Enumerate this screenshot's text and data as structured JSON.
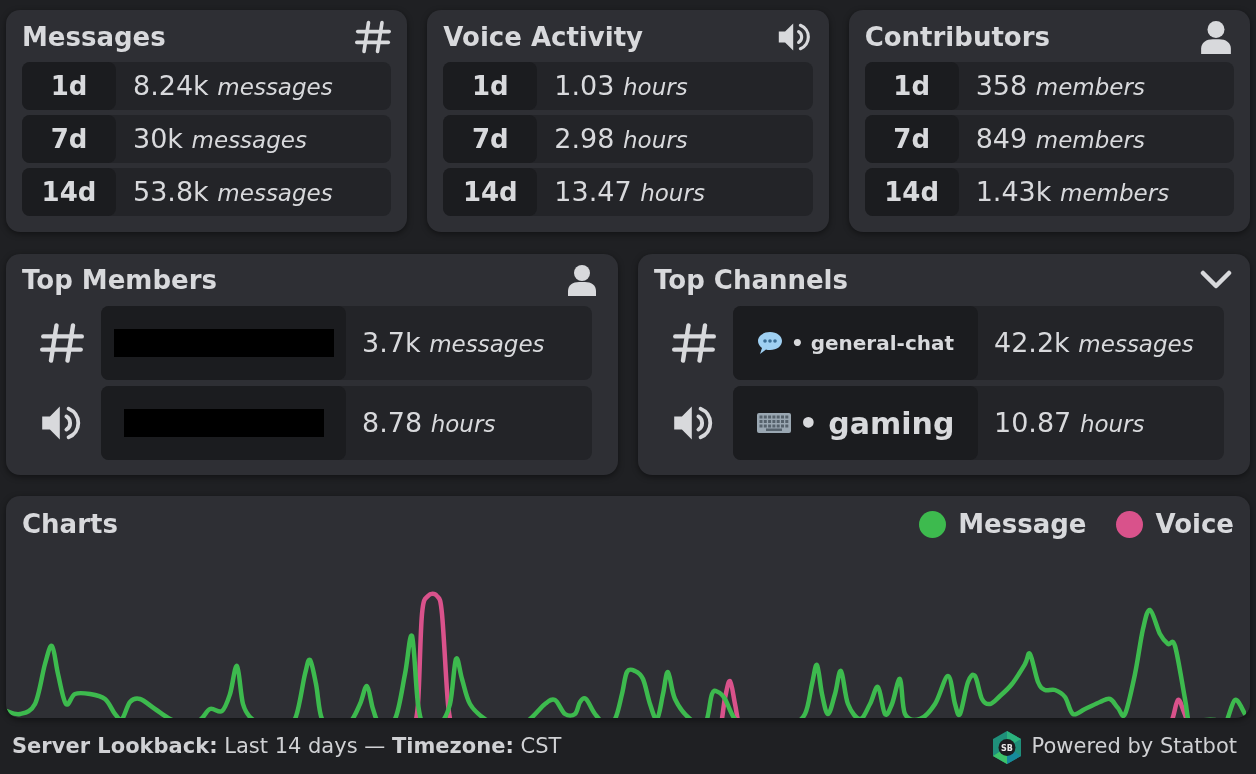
{
  "stat_cards": [
    {
      "title": "Messages",
      "kind": "messages",
      "rows": [
        {
          "period": "1d",
          "value": "8.24k *messages*"
        },
        {
          "period": "7d",
          "value": "30k *messages*"
        },
        {
          "period": "14d",
          "value": "53.8k *messages*"
        }
      ]
    },
    {
      "title": "Voice Activity",
      "kind": "voice",
      "rows": [
        {
          "period": "1d",
          "value": "1.03 *hours*"
        },
        {
          "period": "7d",
          "value": "2.98 *hours*"
        },
        {
          "period": "14d",
          "value": "13.47 *hours*"
        }
      ]
    },
    {
      "title": "Contributors",
      "kind": "members",
      "rows": [
        {
          "period": "1d",
          "value": "358 *members*"
        },
        {
          "period": "7d",
          "value": "849 *members*"
        },
        {
          "period": "14d",
          "value": "1.43k *members*"
        }
      ]
    }
  ],
  "top_members": {
    "title": "Top Members",
    "rows": [
      {
        "kind": "messages",
        "value": "3.7k *messages*"
      },
      {
        "kind": "voice",
        "value": "8.78 *hours*"
      }
    ]
  },
  "top_channels": {
    "title": "Top Channels",
    "rows": [
      {
        "kind": "messages",
        "channel": "• general-chat",
        "value": "42.2k *messages*"
      },
      {
        "kind": "voice",
        "channel": "• gaming",
        "value": "10.87 *hours*"
      }
    ]
  },
  "charts": {
    "title": "Charts",
    "legend": [
      {
        "label": "Message",
        "color": "#3dba4e"
      },
      {
        "label": "Voice",
        "color": "#d9528b"
      }
    ]
  },
  "footer": {
    "lookback": "**Server Lookback:** Last 14 days — **Timezone:** CST",
    "logo_text": "SB",
    "credit": "Powered by Statbot"
  }
}
